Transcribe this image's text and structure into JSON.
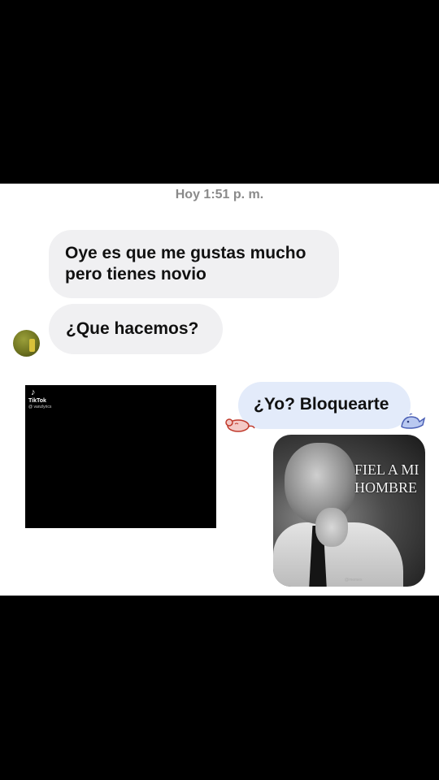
{
  "chat": {
    "timestamp": "Hoy 1:51 p. m.",
    "messages": [
      {
        "sender": "them",
        "text": "Oye es que me gustas mucho\npero tienes novio"
      },
      {
        "sender": "them",
        "text": "¿Que hacemos?"
      },
      {
        "sender": "me",
        "text": "¿Yo? Bloquearte"
      }
    ],
    "video": {
      "logo": "♪",
      "brand": "TikTok",
      "user": "@ vanzlyrics"
    },
    "meme": {
      "caption_line1": "FIEL A MI",
      "caption_line2": "HOMBRE",
      "watermark": "@memes"
    }
  },
  "colors": {
    "incoming_bubble": "#f0f0f2",
    "outgoing_bubble": "#e3ebfa",
    "timestamp": "#8a8a8a",
    "letterbox": "#000000"
  },
  "icons": [
    "tiktok-icon",
    "sleeping-mouse-sticker",
    "whale-sticker",
    "user-avatar"
  ]
}
